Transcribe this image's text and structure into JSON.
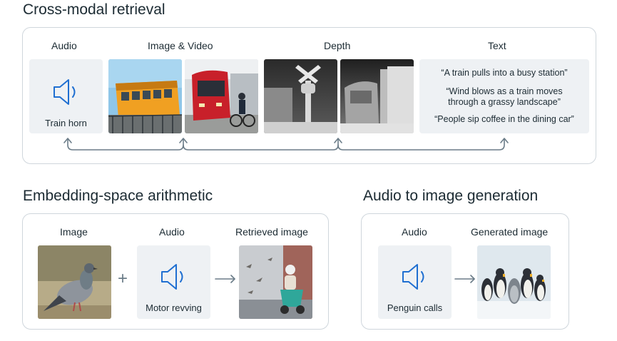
{
  "sections": {
    "cross_modal": {
      "title": "Cross-modal retrieval",
      "columns": {
        "audio": "Audio",
        "image_video": "Image & Video",
        "depth": "Depth",
        "text": "Text"
      },
      "audio_caption": "Train horn",
      "quotes": [
        "“A train pulls into a busy station”",
        "“Wind blows as a train moves through a grassy landscape”",
        "“People sip coffee in the dining car”"
      ]
    },
    "arithmetic": {
      "title": "Embedding-space arithmetic",
      "columns": {
        "image": "Image",
        "audio": "Audio",
        "retrieved": "Retrieved image"
      },
      "audio_caption": "Motor revving",
      "plus": "+"
    },
    "generation": {
      "title": "Audio to image generation",
      "columns": {
        "audio": "Audio",
        "generated": "Generated image"
      },
      "audio_caption": "Penguin calls"
    }
  },
  "colors": {
    "panel_border": "#cfd6dc",
    "tile_bg": "#eef1f4",
    "speaker_blue": "#1f6fd1",
    "connector": "#6b7c88"
  },
  "icons": [
    "speaker-icon",
    "arrow-right-icon",
    "plus-icon"
  ]
}
